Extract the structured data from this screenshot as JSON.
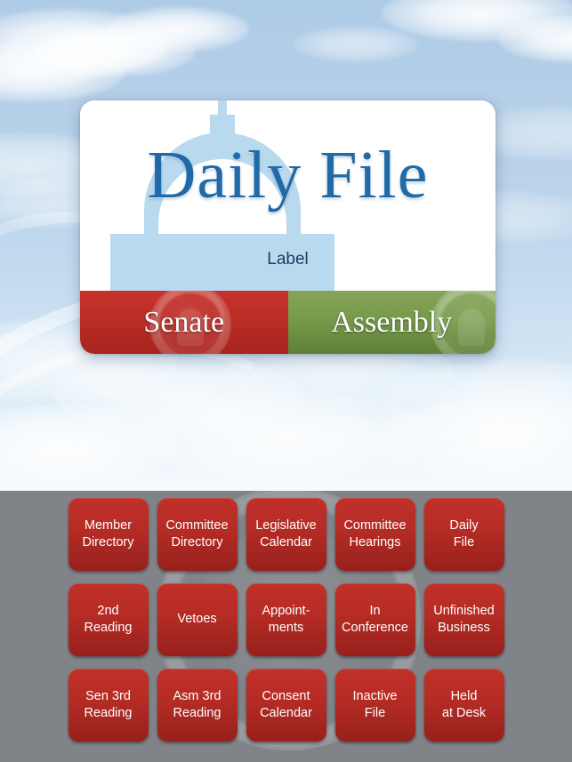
{
  "app": {
    "background_sky_color": "#b4cfe8",
    "panel_color": "#808488"
  },
  "card": {
    "title": "Daily File",
    "subtitle": "Label",
    "title_color": "#1f6aa8",
    "dome_watermark_icon": "capitol-dome-icon",
    "segments": [
      {
        "label": "Senate",
        "color": "#bb2d26",
        "seal_icon": "senate-seal-icon"
      },
      {
        "label": "Assembly",
        "color": "#769a4a",
        "seal_icon": "assembly-seal-icon"
      }
    ]
  },
  "grid": {
    "tile_color": "#b62c25",
    "watermark_icon": "state-seal-watermark-icon",
    "rows": [
      [
        {
          "label": "Member\nDirectory"
        },
        {
          "label": "Committee\nDirectory"
        },
        {
          "label": "Legislative\nCalendar"
        },
        {
          "label": "Committee\nHearings"
        },
        {
          "label": "Daily\nFile"
        }
      ],
      [
        {
          "label": "2nd\nReading"
        },
        {
          "label": "Vetoes"
        },
        {
          "label": "Appoint-\nments"
        },
        {
          "label": "In\nConference"
        },
        {
          "label": "Unfinished\nBusiness"
        }
      ],
      [
        {
          "label": "Sen 3rd\nReading"
        },
        {
          "label": "Asm 3rd\nReading"
        },
        {
          "label": "Consent\nCalendar"
        },
        {
          "label": "Inactive\nFile"
        },
        {
          "label": "Held\nat Desk"
        }
      ]
    ]
  }
}
